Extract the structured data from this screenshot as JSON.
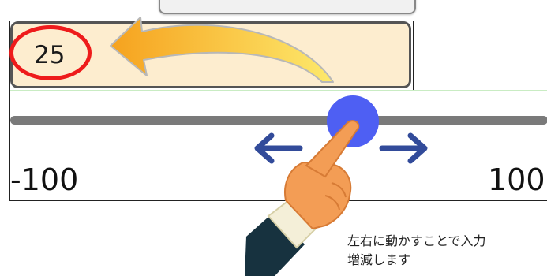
{
  "input": {
    "value": "25"
  },
  "slider": {
    "min_label": "-100",
    "max_label": "100",
    "value": 25
  },
  "caption": {
    "line1": "左右に動かすことで入力",
    "line2": "増減します"
  },
  "colors": {
    "input_bg": "#fdedcf",
    "highlight_ring": "#ee1b1b",
    "thumb": "#4e5ff3",
    "arrow": "#324b9a",
    "callout_arrow": "#f6a21e"
  },
  "icons": {
    "left_arrow": "arrow-left-icon",
    "right_arrow": "arrow-right-icon",
    "hand": "pointing-hand-icon",
    "curved_arrow": "curved-arrow-icon"
  }
}
